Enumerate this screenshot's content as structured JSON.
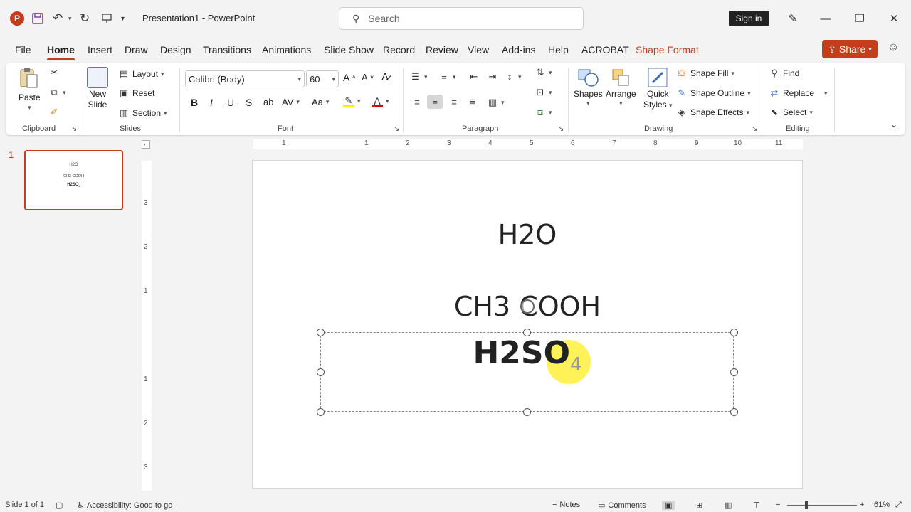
{
  "titlebar": {
    "app_logo": "P",
    "doc_title": "Presentation1  -  PowerPoint",
    "search_placeholder": "Search",
    "signin_label": "Sign in"
  },
  "tabs": [
    "File",
    "Home",
    "Insert",
    "Draw",
    "Design",
    "Transitions",
    "Animations",
    "Slide Show",
    "Record",
    "Review",
    "View",
    "Add-ins",
    "Help",
    "ACROBAT",
    "Shape Format"
  ],
  "active_tab": "Home",
  "share_label": "Share",
  "ribbon": {
    "clipboard": {
      "paste": "Paste",
      "label": "Clipboard"
    },
    "slides": {
      "new_slide_1": "New",
      "new_slide_2": "Slide",
      "layout": "Layout",
      "reset": "Reset",
      "section": "Section",
      "label": "Slides"
    },
    "font": {
      "family": "Calibri (Body)",
      "size": "60",
      "label": "Font",
      "bold": "B",
      "italic": "I",
      "underline": "U",
      "shadow": "S",
      "strike": "ab",
      "spacing": "AV",
      "case": "Aa",
      "color_letter": "A"
    },
    "paragraph": {
      "label": "Paragraph"
    },
    "drawing": {
      "shapes": "Shapes",
      "arrange": "Arrange",
      "quick_styles_1": "Quick",
      "quick_styles_2": "Styles",
      "shape_fill": "Shape Fill",
      "shape_outline": "Shape Outline",
      "shape_effects": "Shape Effects",
      "label": "Drawing"
    },
    "editing": {
      "find": "Find",
      "replace": "Replace",
      "select": "Select",
      "label": "Editing"
    }
  },
  "thumbnail": {
    "number": "1",
    "line1": "H2O",
    "line2": "CH3 COOH",
    "line3": "H2SO",
    "line3_sub": "4"
  },
  "hruler_ticks": [
    "1",
    "1",
    "2",
    "3",
    "4",
    "5",
    "6",
    "7",
    "8",
    "9",
    "10",
    "11"
  ],
  "vruler_ticks": [
    "3",
    "2",
    "1",
    "1",
    "2",
    "3"
  ],
  "slide": {
    "line1": "H2O",
    "line2": "CH3 COOH",
    "line3": "H2SO",
    "line3_sub": "4"
  },
  "status": {
    "slide_info": "Slide 1 of 1",
    "accessibility": "Accessibility: Good to go",
    "notes": "Notes",
    "comments": "Comments",
    "zoom": "61%"
  },
  "colors": {
    "accent": "#c43e1c",
    "highlight": "#fff03c"
  }
}
